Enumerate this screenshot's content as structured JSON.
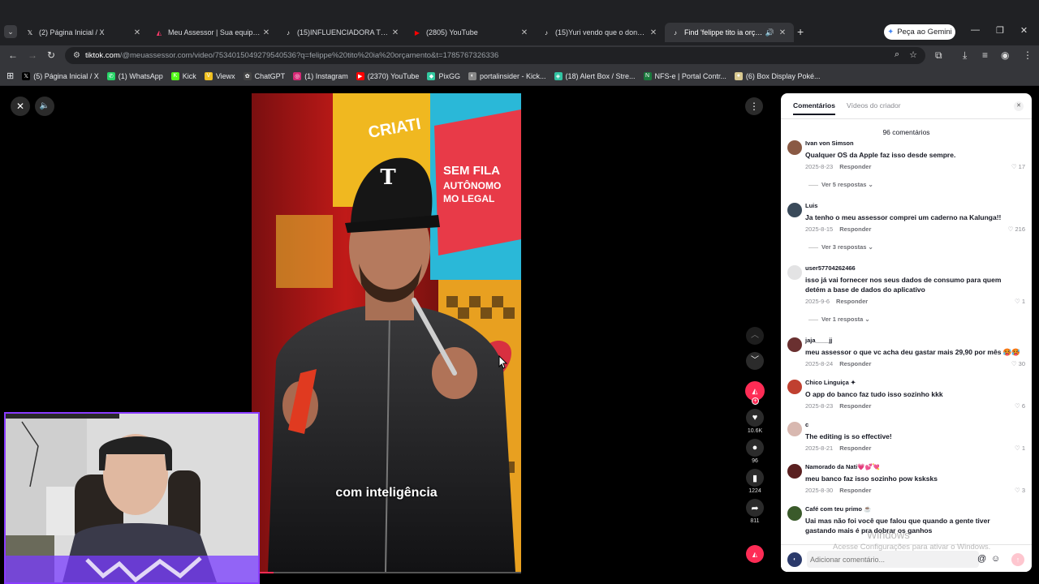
{
  "browser": {
    "tabs": [
      {
        "label": "(2) Página Inicial / X",
        "icon": "x-logo-icon",
        "favicon": "𝕏",
        "color": "#ffffff"
      },
      {
        "label": "Meu Assessor | Sua equipe de assessoria",
        "icon": "meu-assessor-icon",
        "favicon": "◭",
        "color": "#ff3b6b"
      },
      {
        "label": "(15)INFLUENCIADORA TEM CELULAR",
        "icon": "tiktok-icon",
        "favicon": "♪",
        "color": "#ffffff"
      },
      {
        "label": "(2805) YouTube",
        "icon": "youtube-icon",
        "favicon": "▶",
        "color": "#ff0000"
      },
      {
        "label": "(15)Yuri vendo que o dona ta na",
        "icon": "tiktok-icon",
        "favicon": "♪",
        "color": "#ffffff"
      },
      {
        "label": "Find 'felippe tito ia orçamento'",
        "icon": "tiktok-icon",
        "favicon": "♪",
        "color": "#ffffff",
        "active": true
      }
    ],
    "gemini_label": "Peça ao Gemini",
    "url_host": "tiktok.com",
    "url_path": "/@meuassessor.com/video/7534015049279540536?q=felippe%20tito%20ia%20orçamento&t=1785767326336",
    "bookmarks": [
      {
        "label": "(5) Página Inicial / X",
        "favicon": "𝕏",
        "color": "#000000"
      },
      {
        "label": "(1) WhatsApp",
        "favicon": "✆",
        "color": "#25d366"
      },
      {
        "label": "Kick",
        "favicon": "K",
        "color": "#53fc18"
      },
      {
        "label": "Viewx",
        "favicon": "V",
        "color": "#f0c020"
      },
      {
        "label": "ChatGPT",
        "favicon": "✿",
        "color": "#444444"
      },
      {
        "label": "(1) Instagram",
        "favicon": "◎",
        "color": "#d62976"
      },
      {
        "label": "(2370) YouTube",
        "favicon": "▶",
        "color": "#ff0000"
      },
      {
        "label": "PixGG",
        "favicon": "◆",
        "color": "#32c8a0"
      },
      {
        "label": "portalinsider - Kick...",
        "favicon": "◐",
        "color": "#888888"
      },
      {
        "label": "(18) Alert Box / Stre...",
        "favicon": "◈",
        "color": "#31c3a2"
      },
      {
        "label": "NFS-e | Portal Contr...",
        "favicon": "N",
        "color": "#1b7a3d"
      },
      {
        "label": "(6) Box Display Poké...",
        "favicon": "●",
        "color": "#d8c890"
      }
    ]
  },
  "video": {
    "caption": "com inteligência",
    "progress": 0.08,
    "likes": "10.6K",
    "comments": "96",
    "saves": "1224",
    "shares": "811"
  },
  "comments_panel": {
    "tab_comments": "Comentários",
    "tab_creator_videos": "Vídeos do criador",
    "count_label": "96 comentários",
    "reply_label": "Responder",
    "input_placeholder": "Adicionar comentário...",
    "comments": [
      {
        "user": "Ivan von Simson",
        "text": "Qualquer OS da Apple faz isso desde sempre.",
        "date": "2025-8-23",
        "likes": "17",
        "replies": "Ver 5 respostas ⌄",
        "avatar_color": "#8a5a44"
      },
      {
        "user": "Luis",
        "text": "Ja tenho o meu assessor comprei um caderno na Kalunga!!",
        "date": "2025-8-15",
        "likes": "216",
        "replies": "Ver 3 respostas ⌄",
        "avatar_color": "#3a4a5a"
      },
      {
        "user": "user57704262466",
        "text": "isso já vai fornecer nos seus dados de consumo para quem detém a base de dados do aplicativo",
        "date": "2025-9-6",
        "likes": "1",
        "replies": "Ver 1 resposta ⌄",
        "avatar_color": "#e3e3e4"
      },
      {
        "user": "jaja____jj",
        "text": "meu assessor o que vc acha deu gastar mais 29,90 por mês 🥵🥵",
        "date": "2025-8-24",
        "likes": "30",
        "avatar_color": "#6a3030"
      },
      {
        "user": "Chico Linguiça ✦",
        "text": "O app do banco faz tudo isso sozinho kkk",
        "date": "2025-8-23",
        "likes": "6",
        "avatar_color": "#c04030"
      },
      {
        "user": "c",
        "text": "The editing is so effective!",
        "date": "2025-8-21",
        "likes": "1",
        "avatar_color": "#d8b8b0"
      },
      {
        "user": "Namorado da Nati💗💕💘",
        "text": "meu banco faz isso sozinho pow ksksks",
        "date": "2025-8-30",
        "likes": "3",
        "avatar_color": "#5a2020"
      },
      {
        "user": "Café com teu primo ☕",
        "text": "Uai mas não foi você que falou que quando a gente tiver gastando mais é pra dobrar os ganhos",
        "date": "",
        "likes": "",
        "avatar_color": "#3a5a2a"
      }
    ]
  },
  "watermark": {
    "line1": "Windows",
    "line2": "Acesse Configurações para ativar o Windows."
  },
  "colors": {
    "tiktok_accent": "#fe2c55",
    "webcam_border": "#8a3cff"
  }
}
